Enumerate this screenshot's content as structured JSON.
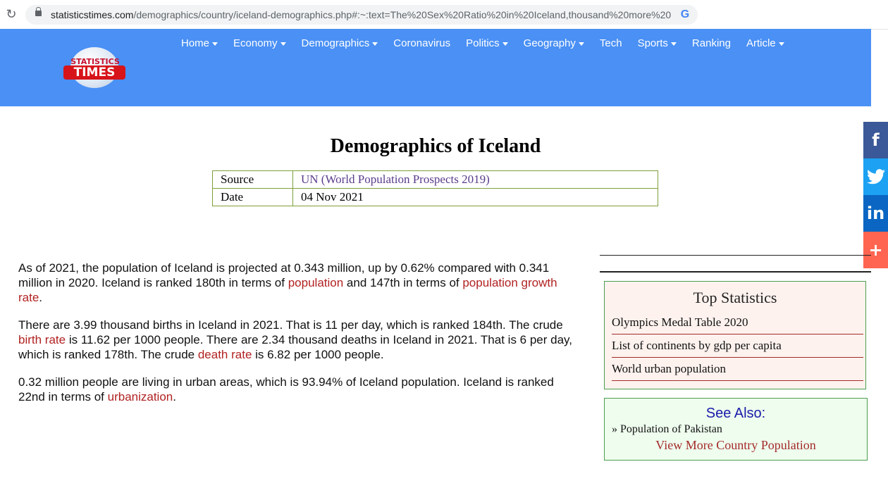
{
  "browser": {
    "url_domain": "statisticstimes.com",
    "url_path": "/demographics/country/iceland-demographics.php#:~:text=The%20Sex%20Ratio%20in%20Iceland,thousand%20more%20..."
  },
  "logo": {
    "line1": "STATISTICS",
    "line2": "TIMES"
  },
  "nav": [
    {
      "label": "Home",
      "dropdown": true
    },
    {
      "label": "Economy",
      "dropdown": true
    },
    {
      "label": "Demographics",
      "dropdown": true
    },
    {
      "label": "Coronavirus",
      "dropdown": false
    },
    {
      "label": "Politics",
      "dropdown": true
    },
    {
      "label": "Geography",
      "dropdown": true
    },
    {
      "label": "Tech",
      "dropdown": false
    },
    {
      "label": "Sports",
      "dropdown": true
    },
    {
      "label": "Ranking",
      "dropdown": false
    },
    {
      "label": "Article",
      "dropdown": true
    }
  ],
  "page": {
    "title": "Demographics of Iceland"
  },
  "source_table": {
    "source_label": "Source",
    "source_value": "UN (World Population Prospects 2019)",
    "date_label": "Date",
    "date_value": "04 Nov 2021"
  },
  "article": {
    "p1": {
      "t1": "As of 2021, the population of Iceland is projected at 0.343 million, up by 0.62% compared with 0.341 million in 2020. Iceland is ranked 180th in terms of ",
      "l1": "population",
      "t2": " and 147th in terms of ",
      "l2": "population growth rate",
      "t3": "."
    },
    "p2": {
      "t1": "There are 3.99 thousand births in Iceland in 2021. That is 11 per day, which is ranked 184th. The crude ",
      "l1": "birth rate",
      "t2": " is 11.62 per 1000 people. There are 2.34 thousand deaths in Iceland in 2021. That is 6 per day, which is ranked 178th. The crude ",
      "l2": "death rate",
      "t3": " is 6.82 per 1000 people."
    },
    "p3": {
      "t1": "0.32 million people are living in urban areas, which is 93.94% of Iceland population. Iceland is ranked 22nd in terms of ",
      "l1": "urbanization",
      "t2": "."
    }
  },
  "top_statistics": {
    "heading": "Top Statistics",
    "items": [
      "Olympics Medal Table 2020",
      "List of continents by gdp per capita",
      "World urban population"
    ]
  },
  "see_also": {
    "heading": "See Also:",
    "item": "» Population of Pakistan",
    "more": "View More Country Population"
  },
  "share": {
    "facebook": "f",
    "linkedin": "in",
    "plus": "+"
  },
  "colors": {
    "header_bg": "#4a90f5",
    "link_red": "#b22222",
    "facebook": "#3b5998",
    "twitter": "#1da1f2",
    "linkedin": "#0a66c2",
    "addthis": "#ff6550"
  }
}
